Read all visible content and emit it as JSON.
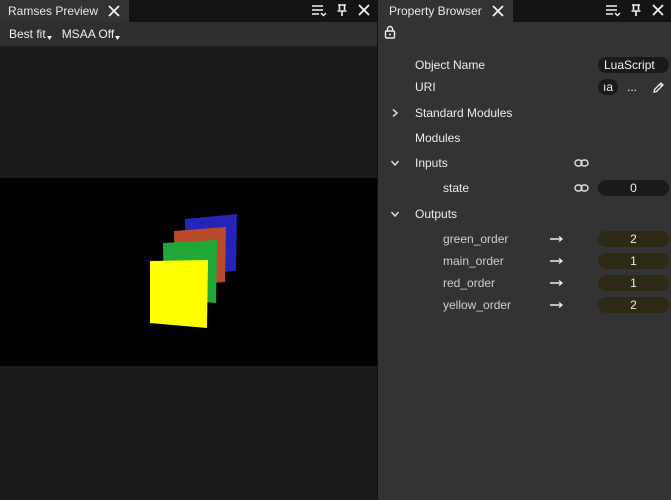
{
  "preview": {
    "tab_title": "Ramses Preview",
    "toolbar": {
      "fit_mode": "Best fit",
      "msaa": "MSAA Off"
    },
    "scene_colors": {
      "blue": "#2424b8",
      "red": "#b94b2c",
      "green": "#21a83a",
      "yellow": "#ffff00"
    }
  },
  "property_browser": {
    "tab_title": "Property Browser",
    "object_name_label": "Object Name",
    "object_name_value": "LuaScript",
    "uri_label": "URI",
    "uri_value": "ıa",
    "uri_browse": "...",
    "standard_modules_label": "Standard Modules",
    "modules_label": "Modules",
    "inputs_label": "Inputs",
    "inputs": [
      {
        "name": "state",
        "value": "0"
      }
    ],
    "outputs_label": "Outputs",
    "outputs": [
      {
        "name": "green_order",
        "value": "2"
      },
      {
        "name": "main_order",
        "value": "1"
      },
      {
        "name": "red_order",
        "value": "1"
      },
      {
        "name": "yellow_order",
        "value": "2"
      }
    ]
  }
}
